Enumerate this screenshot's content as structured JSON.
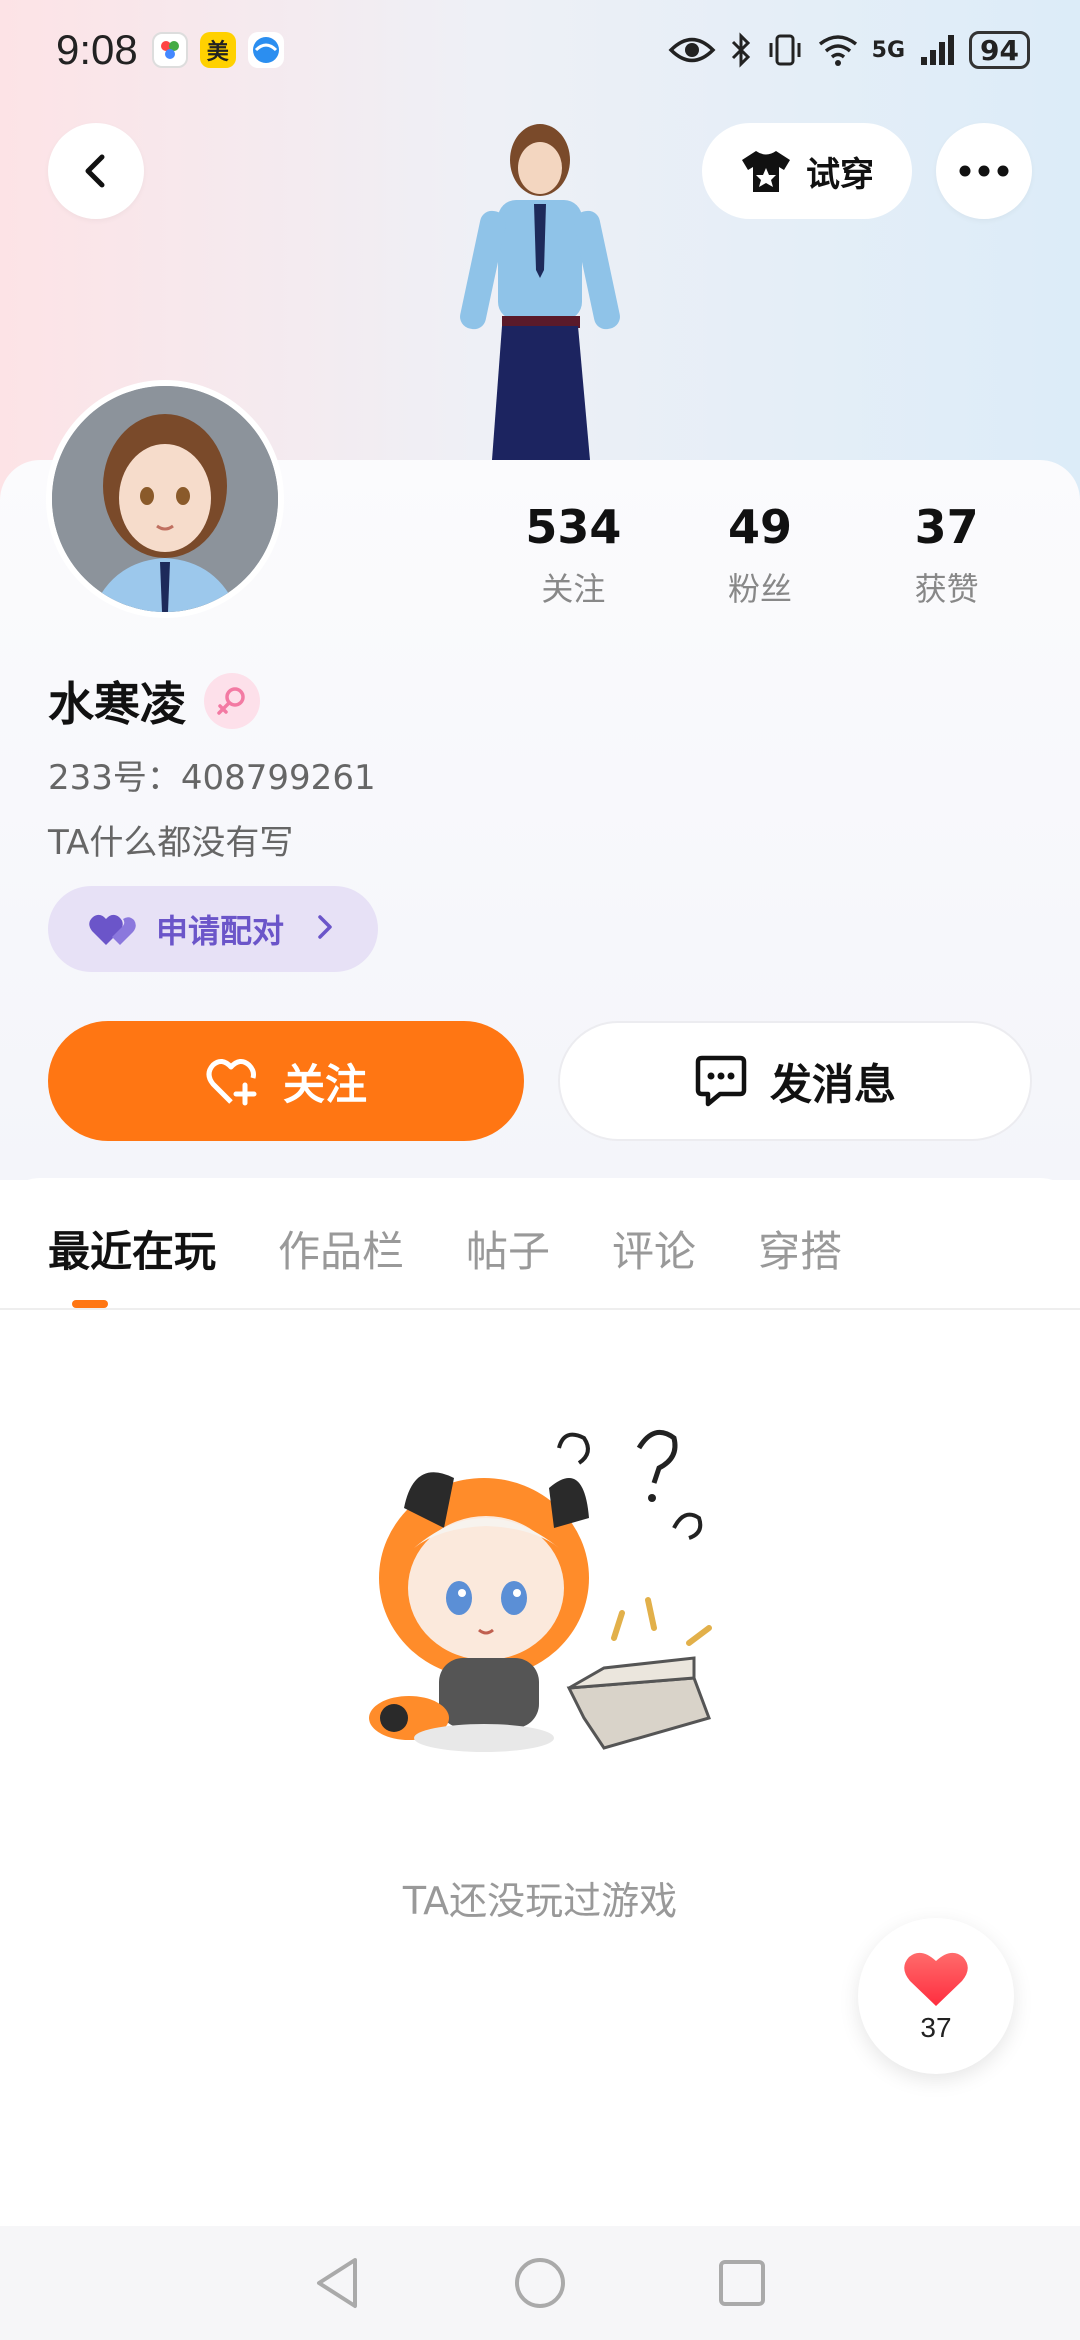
{
  "status_bar": {
    "time": "9:08",
    "app_badge_mei": "美",
    "network": "5G",
    "battery": "94"
  },
  "header": {
    "try_on_label": "试穿"
  },
  "profile": {
    "name": "水寒凌",
    "uid": "233号：408799261",
    "bio": "TA什么都没有写",
    "pair_label": "申请配对",
    "stats": [
      {
        "value": "534",
        "label": "关注"
      },
      {
        "value": "49",
        "label": "粉丝"
      },
      {
        "value": "37",
        "label": "获赞"
      }
    ]
  },
  "actions": {
    "follow_label": "关注",
    "message_label": "发消息"
  },
  "tabs": [
    {
      "label": "最近在玩",
      "active": true
    },
    {
      "label": "作品栏",
      "active": false
    },
    {
      "label": "帖子",
      "active": false
    },
    {
      "label": "评论",
      "active": false
    },
    {
      "label": "穿搭",
      "active": false
    }
  ],
  "empty_state": {
    "text": "TA还没玩过游戏"
  },
  "like_fab": {
    "count": "37"
  },
  "colors": {
    "accent": "#ff7613",
    "pair_bg": "#e7e1f6",
    "pair_text": "#6b55c9",
    "gender": "#f37aa3"
  },
  "icons": {
    "back": "chevron-left-icon",
    "tshirt": "tshirt-icon",
    "more": "more-dots-icon",
    "heart_add": "heart-plus-icon",
    "chat": "chat-bubble-icon",
    "pair": "double-heart-icon",
    "like": "heart-icon"
  }
}
